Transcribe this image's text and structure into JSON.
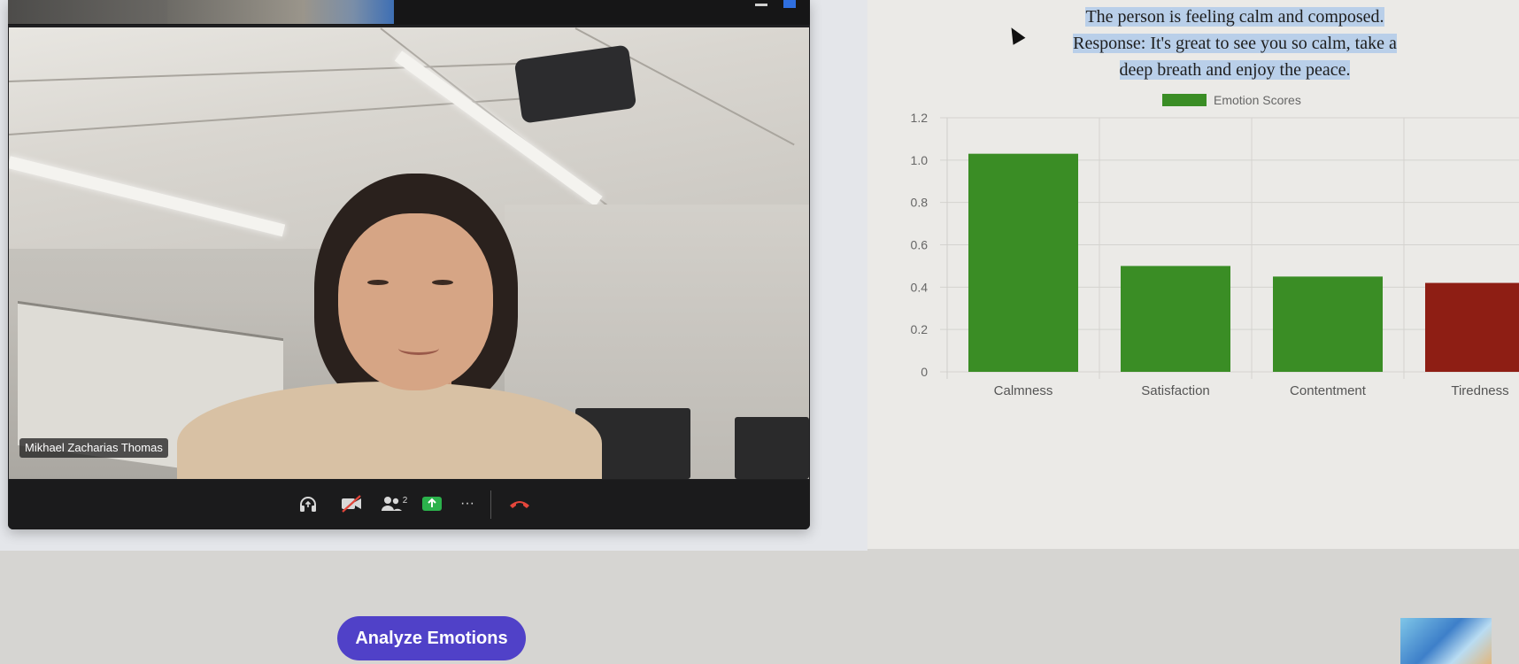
{
  "video_call": {
    "participant_name": "Mikhael Zacharias Thomas",
    "toolbar": {
      "audio_icon": "headphones-icon",
      "video_icon": "video-off-icon",
      "participants_icon": "participants-icon",
      "participants_count": "2",
      "share_icon": "share-screen-icon",
      "more_icon": "more-icon",
      "more_label": "···",
      "end_icon": "end-call-icon"
    }
  },
  "analysis": {
    "line1": "The person is feeling calm and composed.",
    "line2": "Response: It's great to see you so calm, take a",
    "line3": "deep breath and enjoy the peace."
  },
  "analyze_button": {
    "label": "Analyze Emotions"
  },
  "colors": {
    "positive": "#3a8d25",
    "negative": "#8e1e14",
    "accent": "#5041c8",
    "highlight": "#b9cfe9"
  },
  "chart_data": {
    "type": "bar",
    "categories": [
      "Calmness",
      "Satisfaction",
      "Contentment",
      "Tiredness"
    ],
    "series": [
      {
        "name": "Emotion Scores",
        "values": [
          1.03,
          0.5,
          0.45,
          0.42
        ]
      }
    ],
    "bar_colors": [
      "#3a8d25",
      "#3a8d25",
      "#3a8d25",
      "#8e1e14"
    ],
    "ylim": [
      0,
      1.2
    ],
    "yticks": [
      "0",
      "0.2",
      "0.4",
      "0.6",
      "0.8",
      "1.0",
      "1.2"
    ],
    "legend_position": "top",
    "grid": true
  }
}
